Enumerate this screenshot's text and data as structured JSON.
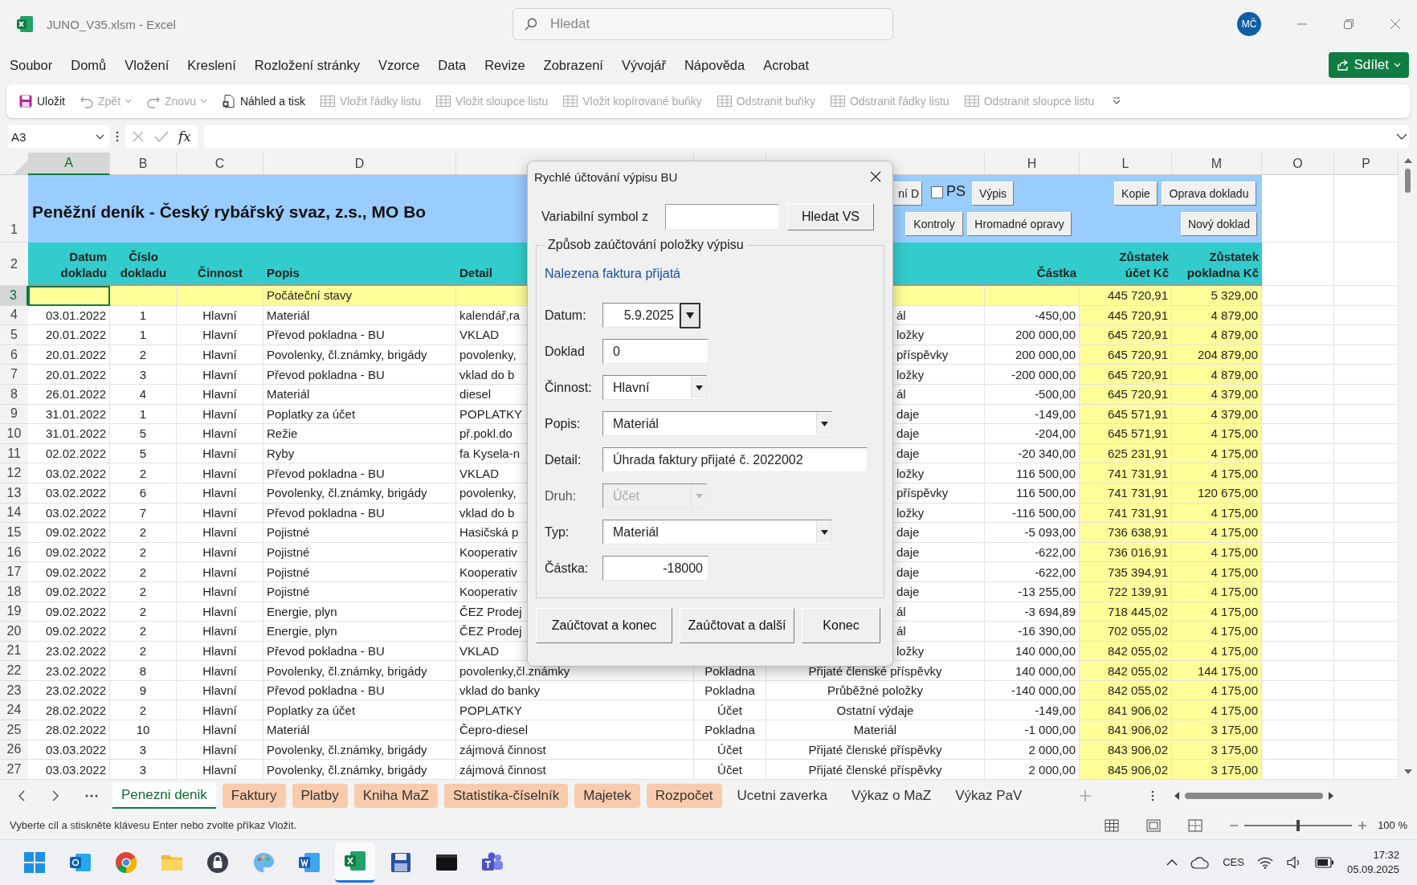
{
  "window": {
    "title": "JUNO_V35.xlsm  -  Excel",
    "search_placeholder": "Hledat",
    "user_initials": "MČ"
  },
  "menu": [
    "Soubor",
    "Domů",
    "Vložení",
    "Kreslení",
    "Rozložení stránky",
    "Vzorce",
    "Data",
    "Revize",
    "Zobrazení",
    "Vývojář",
    "Nápověda",
    "Acrobat"
  ],
  "share_button": "Sdílet",
  "toolbar": [
    {
      "label": "Uložit",
      "kind": "save",
      "disabled": false,
      "dropdown": false
    },
    {
      "label": "Zpět",
      "kind": "undo",
      "disabled": true,
      "dropdown": true
    },
    {
      "label": "Znovu",
      "kind": "redo",
      "disabled": true,
      "dropdown": true
    },
    {
      "label": "Náhled a tisk",
      "kind": "print",
      "disabled": false,
      "dropdown": false
    },
    {
      "label": "Vložit řádky listu",
      "kind": "grid",
      "disabled": true,
      "dropdown": false
    },
    {
      "label": "Vložit sloupce listu",
      "kind": "grid",
      "disabled": true,
      "dropdown": false
    },
    {
      "label": "Vložit kopírované buňky",
      "kind": "grid",
      "disabled": true,
      "dropdown": false
    },
    {
      "label": "Odstranit buňky",
      "kind": "grid",
      "disabled": true,
      "dropdown": false
    },
    {
      "label": "Odstranit řádky listu",
      "kind": "grid",
      "disabled": true,
      "dropdown": false
    },
    {
      "label": "Odstranit sloupce listu",
      "kind": "grid",
      "disabled": true,
      "dropdown": false
    }
  ],
  "formula_bar": {
    "name_box": "A3",
    "function_label": "fx"
  },
  "sheet": {
    "column_headers": [
      {
        "label": "A",
        "selected": true
      },
      {
        "label": "B",
        "selected": false
      },
      {
        "label": "C",
        "selected": false
      },
      {
        "label": "D",
        "selected": false
      },
      {
        "label": "H",
        "selected": false
      },
      {
        "label": "L",
        "selected": false
      },
      {
        "label": "M",
        "selected": false
      },
      {
        "label": "O",
        "selected": false
      },
      {
        "label": "P",
        "selected": false
      }
    ],
    "title_row": {
      "row": "1",
      "title": "Peněžní deník - Český rybářský svaz, z.s., MO Bo",
      "ps_checkbox": {
        "label": "PS",
        "checked": false
      },
      "buttons": [
        "ní D",
        "Výpis",
        "Kopie",
        "Oprava dokladu",
        "Kontroly",
        "Hromadné opravy",
        "Nový doklad"
      ]
    },
    "header_row": {
      "row": "2",
      "date": "Datum\ndokladu",
      "number": "Číslo\ndokladu",
      "activity": "Činnost",
      "description": "Popis",
      "detail": "Detail",
      "amount": "Částka",
      "account_balance": "Zůstatek\núčet Kč",
      "cash_balance": "Zůstatek\npokladna Kč"
    },
    "rows": [
      {
        "row": "3",
        "kind": "opening",
        "selected": true,
        "description": "Počáteční stavy",
        "account_balance": "445 720,91",
        "cash_balance": "5 329,00"
      },
      {
        "row": "4",
        "kind": "entry",
        "selected": false,
        "date": "03.01.2022",
        "number": "1",
        "activity": "Hlavní",
        "description": "Materiál",
        "detail": "kalendář,ra",
        "category": "ál",
        "amount": "-450,00",
        "account_balance": "445 720,91",
        "cash_balance": "4 879,00"
      },
      {
        "row": "5",
        "kind": "entry",
        "selected": false,
        "date": "20.01.2022",
        "number": "1",
        "activity": "Hlavní",
        "description": "Převod pokladna - BU",
        "detail": "VKLAD",
        "category": "ložky",
        "amount": "200 000,00",
        "account_balance": "645 720,91",
        "cash_balance": "4 879,00"
      },
      {
        "row": "6",
        "kind": "entry",
        "selected": false,
        "date": "20.01.2022",
        "number": "2",
        "activity": "Hlavní",
        "description": "Povolenky, čl.známky, brigády",
        "detail": "povolenky,",
        "category": "příspěvky",
        "amount": "200 000,00",
        "account_balance": "645 720,91",
        "cash_balance": "204 879,00"
      },
      {
        "row": "7",
        "kind": "entry",
        "selected": false,
        "date": "20.01.2022",
        "number": "3",
        "activity": "Hlavní",
        "description": "Převod pokladna - BU",
        "detail": "vklad do b",
        "category": "ložky",
        "amount": "-200 000,00",
        "account_balance": "645 720,91",
        "cash_balance": "4 879,00"
      },
      {
        "row": "8",
        "kind": "entry",
        "selected": false,
        "date": "26.01.2022",
        "number": "4",
        "activity": "Hlavní",
        "description": "Materiál",
        "detail": "diesel",
        "category": "ál",
        "amount": "-500,00",
        "account_balance": "645 720,91",
        "cash_balance": "4 379,00"
      },
      {
        "row": "9",
        "kind": "entry",
        "selected": false,
        "date": "31.01.2022",
        "number": "1",
        "activity": "Hlavní",
        "description": "Poplatky za účet",
        "detail": "POPLATKY",
        "category": "daje",
        "amount": "-149,00",
        "account_balance": "645 571,91",
        "cash_balance": "4 379,00"
      },
      {
        "row": "10",
        "kind": "entry",
        "selected": false,
        "date": "31.01.2022",
        "number": "5",
        "activity": "Hlavní",
        "description": "Režie",
        "detail": "př.pokl.do",
        "category": "daje",
        "amount": "-204,00",
        "account_balance": "645 571,91",
        "cash_balance": "4 175,00"
      },
      {
        "row": "11",
        "kind": "entry",
        "selected": false,
        "date": "02.02.2022",
        "number": "5",
        "activity": "Hlavní",
        "description": "Ryby",
        "detail": "fa Kysela-n",
        "category": "daje",
        "amount": "-20 340,00",
        "account_balance": "625 231,91",
        "cash_balance": "4 175,00"
      },
      {
        "row": "12",
        "kind": "entry",
        "selected": false,
        "date": "03.02.2022",
        "number": "2",
        "activity": "Hlavní",
        "description": "Převod pokladna - BU",
        "detail": "VKLAD",
        "category": "ložky",
        "amount": "116 500,00",
        "account_balance": "741 731,91",
        "cash_balance": "4 175,00"
      },
      {
        "row": "13",
        "kind": "entry",
        "selected": false,
        "date": "03.02.2022",
        "number": "6",
        "activity": "Hlavní",
        "description": "Povolenky, čl.známky, brigády",
        "detail": "povolenky,",
        "category": "příspěvky",
        "amount": "116 500,00",
        "account_balance": "741 731,91",
        "cash_balance": "120 675,00"
      },
      {
        "row": "14",
        "kind": "entry",
        "selected": false,
        "date": "03.02.2022",
        "number": "7",
        "activity": "Hlavní",
        "description": "Převod pokladna - BU",
        "detail": "vklad do b",
        "category": "ložky",
        "amount": "-116 500,00",
        "account_balance": "741 731,91",
        "cash_balance": "4 175,00"
      },
      {
        "row": "15",
        "kind": "entry",
        "selected": false,
        "date": "09.02.2022",
        "number": "2",
        "activity": "Hlavní",
        "description": "Pojistné",
        "detail": "Hasičská p",
        "category": "daje",
        "amount": "-5 093,00",
        "account_balance": "736 638,91",
        "cash_balance": "4 175,00"
      },
      {
        "row": "16",
        "kind": "entry",
        "selected": false,
        "date": "09.02.2022",
        "number": "2",
        "activity": "Hlavní",
        "description": "Pojistné",
        "detail": "Kooperativ",
        "category": "daje",
        "amount": "-622,00",
        "account_balance": "736 016,91",
        "cash_balance": "4 175,00"
      },
      {
        "row": "17",
        "kind": "entry",
        "selected": false,
        "date": "09.02.2022",
        "number": "2",
        "activity": "Hlavní",
        "description": "Pojistné",
        "detail": "Kooperativ",
        "category": "daje",
        "amount": "-622,00",
        "account_balance": "735 394,91",
        "cash_balance": "4 175,00"
      },
      {
        "row": "18",
        "kind": "entry",
        "selected": false,
        "date": "09.02.2022",
        "number": "2",
        "activity": "Hlavní",
        "description": "Pojistné",
        "detail": "Kooperativ",
        "category": "daje",
        "amount": "-13 255,00",
        "account_balance": "722 139,91",
        "cash_balance": "4 175,00"
      },
      {
        "row": "19",
        "kind": "entry",
        "selected": false,
        "date": "09.02.2022",
        "number": "2",
        "activity": "Hlavní",
        "description": "Energie, plyn",
        "detail": "ČEZ Prodej",
        "category": "ál",
        "amount": "-3 694,89",
        "account_balance": "718 445,02",
        "cash_balance": "4 175,00"
      },
      {
        "row": "20",
        "kind": "entry",
        "selected": false,
        "date": "09.02.2022",
        "number": "2",
        "activity": "Hlavní",
        "description": "Energie, plyn",
        "detail": "ČEZ Prodej",
        "category": "ál",
        "amount": "-16 390,00",
        "account_balance": "702 055,02",
        "cash_balance": "4 175,00"
      },
      {
        "row": "21",
        "kind": "entry",
        "selected": false,
        "date": "23.02.2022",
        "number": "2",
        "activity": "Hlavní",
        "description": "Převod pokladna - BU",
        "detail": "VKLAD",
        "category": "ložky",
        "amount": "140 000,00",
        "account_balance": "842 055,02",
        "cash_balance": "4 175,00"
      },
      {
        "row": "22",
        "kind": "entry",
        "selected": false,
        "date": "23.02.2022",
        "number": "8",
        "activity": "Hlavní",
        "description": "Povolenky, čl.známky, brigády",
        "detail": "povolenky,čl.známky",
        "account_type": "Pokladna",
        "category": "Přijaté členské příspěvky",
        "amount": "140 000,00",
        "account_balance": "842 055,02",
        "cash_balance": "144 175,00"
      },
      {
        "row": "23",
        "kind": "entry",
        "selected": false,
        "date": "23.02.2022",
        "number": "9",
        "activity": "Hlavní",
        "description": "Převod pokladna - BU",
        "detail": "vklad do banky",
        "account_type": "Pokladna",
        "category": "Průběžné položky",
        "amount": "-140 000,00",
        "account_balance": "842 055,02",
        "cash_balance": "4 175,00"
      },
      {
        "row": "24",
        "kind": "entry",
        "selected": false,
        "date": "28.02.2022",
        "number": "2",
        "activity": "Hlavní",
        "description": "Poplatky za účet",
        "detail": "POPLATKY",
        "account_type": "Účet",
        "category": "Ostatní výdaje",
        "amount": "-149,00",
        "account_balance": "841 906,02",
        "cash_balance": "4 175,00"
      },
      {
        "row": "25",
        "kind": "entry",
        "selected": false,
        "date": "28.02.2022",
        "number": "10",
        "activity": "Hlavní",
        "description": "Materiál",
        "detail": "Čepro-diesel",
        "account_type": "Pokladna",
        "category": "Materiál",
        "amount": "-1 000,00",
        "account_balance": "841 906,02",
        "cash_balance": "3 175,00"
      },
      {
        "row": "26",
        "kind": "entry",
        "selected": false,
        "date": "03.03.2022",
        "number": "3",
        "activity": "Hlavní",
        "description": "Povolenky, čl.známky, brigády",
        "detail": "zájmová činnost",
        "account_type": "Účet",
        "category": "Přijaté členské příspěvky",
        "amount": "2 000,00",
        "account_balance": "843 906,02",
        "cash_balance": "3 175,00"
      },
      {
        "row": "27",
        "kind": "entry",
        "selected": false,
        "date": "03.03.2022",
        "number": "3",
        "activity": "Hlavní",
        "description": "Povolenky, čl.známky, brigády",
        "detail": "zájmová činnost",
        "account_type": "Účet",
        "category": "Přijaté členské příspěvky",
        "amount": "2 000,00",
        "account_balance": "845 906,02",
        "cash_balance": "3 175,00"
      }
    ]
  },
  "dialog": {
    "title": "Rychlé účtování výpisu BU",
    "vs_label": "Variabilní symbol z",
    "search_button": "Hledat VS",
    "group_title": "Způsob zaúčtování položky výpisu",
    "status": "Nalezena faktura přijatá",
    "fields": [
      {
        "label": "Datum:",
        "value": "5.9.2025",
        "kind": "date",
        "disabled": false
      },
      {
        "label": "Doklad",
        "value": "0",
        "kind": "text",
        "disabled": false
      },
      {
        "label": "Činnost:",
        "value": "Hlavní",
        "kind": "combo",
        "disabled": false
      },
      {
        "label": "Popis:",
        "value": "Materiál",
        "kind": "combo",
        "disabled": false
      },
      {
        "label": "Detail:",
        "value": "Úhrada faktury přijaté č. 2022002",
        "kind": "text",
        "disabled": false
      },
      {
        "label": "Druh:",
        "value": "Účet",
        "kind": "combo",
        "disabled": true
      },
      {
        "label": "Typ:",
        "value": "Materiál",
        "kind": "combo",
        "disabled": false
      },
      {
        "label": "Částka:",
        "value": "-18000",
        "kind": "number",
        "disabled": false
      }
    ],
    "buttons": [
      "Zaúčtovat a konec",
      "Zaúčtovat a další",
      "Konec"
    ]
  },
  "sheet_tabs": [
    {
      "label": "Penezni denik",
      "selected": true
    },
    {
      "label": "Faktury",
      "selected": false,
      "color": "#f8cbad"
    },
    {
      "label": "Platby",
      "selected": false,
      "color": "#f8cbad"
    },
    {
      "label": "Kniha MaZ",
      "selected": false,
      "color": "#f8cbad"
    },
    {
      "label": "Statistika-číselník",
      "selected": false,
      "color": "#f8cbad"
    },
    {
      "label": "Majetek",
      "selected": false,
      "color": "#f8cbad"
    },
    {
      "label": "Rozpočet",
      "selected": false,
      "color": "#f8cbad"
    },
    {
      "label": "Ucetni zaverka",
      "selected": false
    },
    {
      "label": "Výkaz o MaZ",
      "selected": false
    },
    {
      "label": "Výkaz PaV",
      "selected": false
    }
  ],
  "status_bar": {
    "message": "Vyberte cíl a stiskněte klávesu Enter nebo zvolte příkaz Vložit.",
    "zoom": {
      "level": 0.5,
      "reading": "100 %"
    }
  },
  "taskbar": {
    "apps": [
      {
        "kind": "start",
        "selected": false
      },
      {
        "kind": "mail",
        "selected": false
      },
      {
        "kind": "browser",
        "selected": false
      },
      {
        "kind": "folder",
        "selected": false
      },
      {
        "kind": "lock",
        "selected": false
      },
      {
        "kind": "palette",
        "selected": false
      },
      {
        "kind": "word",
        "selected": false
      },
      {
        "kind": "excel",
        "selected": true
      },
      {
        "kind": "disk",
        "selected": false
      },
      {
        "kind": "terminal",
        "selected": false
      },
      {
        "kind": "teams",
        "selected": false
      }
    ],
    "tray": {
      "language": "CES",
      "time": "17:32",
      "date": "05.09.2025"
    }
  }
}
